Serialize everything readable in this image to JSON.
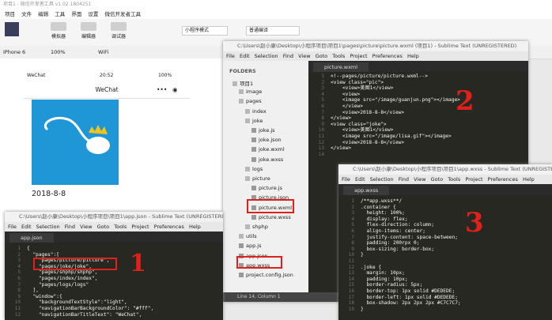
{
  "ide": {
    "title": "项目1 - 微信开发者工具 v1.02.1804251",
    "menu": [
      "项目",
      "文件",
      "编辑",
      "工具",
      "界面",
      "设置",
      "微信开发者工具"
    ],
    "toolbar": {
      "simulator": "模拟器",
      "editor": "编辑器",
      "debugger": "调试器",
      "mode": "小程序模式",
      "compile": "普通编译"
    },
    "device": "iPhone 6",
    "zoom": "100%",
    "network": "WiFi"
  },
  "phone": {
    "carrier": "WeChat",
    "time": "20:52",
    "battery": "100%",
    "nav_title": "WeChat",
    "date_text": "2018-8-8"
  },
  "top_window": {
    "title": "C:\\Users\\赵小康\\Desktop\\小程序项目\\项目1\\pages\\picture\\picture.wxml (项目1) - Sublime Text (UNREGISTERED)",
    "menu": [
      "File",
      "Edit",
      "Selection",
      "Find",
      "View",
      "Goto",
      "Tools",
      "Project",
      "Preferences",
      "Help"
    ],
    "tab": "picture.wxml",
    "sidebar_header": "FOLDERS",
    "tree": [
      {
        "label": "项目1",
        "kind": "folder"
      },
      {
        "label": "image",
        "kind": "folder"
      },
      {
        "label": "pages",
        "kind": "folder"
      },
      {
        "label": "index",
        "kind": "folder"
      },
      {
        "label": "joke",
        "kind": "folder"
      },
      {
        "label": "joke.js",
        "kind": "file"
      },
      {
        "label": "joke.json",
        "kind": "file"
      },
      {
        "label": "joke.wxml",
        "kind": "file"
      },
      {
        "label": "joke.wxss",
        "kind": "file"
      },
      {
        "label": "logs",
        "kind": "folder"
      },
      {
        "label": "picture",
        "kind": "folder"
      },
      {
        "label": "picture.js",
        "kind": "file"
      },
      {
        "label": "picture.json",
        "kind": "file"
      },
      {
        "label": "picture.wxml",
        "kind": "file"
      },
      {
        "label": "picture.wxss",
        "kind": "file"
      },
      {
        "label": "shphp",
        "kind": "folder"
      },
      {
        "label": "utils",
        "kind": "folder"
      },
      {
        "label": "app.js",
        "kind": "file"
      },
      {
        "label": "app.json",
        "kind": "file"
      },
      {
        "label": "app.wxss",
        "kind": "file"
      },
      {
        "label": "project.config.json",
        "kind": "file"
      }
    ],
    "code": [
      "<!--pages/picture/picture.wxml-->",
      "<view class=\"pic\">",
      "    <view>美图1</view>",
      "    <view>",
      "    <image src=\"/image/guanjun.png\"></image>",
      "    </view>",
      "    <view>2018-8-8</view>",
      "</view>",
      "<view class=\"joke\">",
      "    <view>美图1</view>",
      "    <image src=\"/image/lisa.gif\"></image>",
      "    <view>2018-8-8</view>",
      "</view>",
      ""
    ],
    "status": "Line 14, Column 1"
  },
  "left_window": {
    "title": "C:\\Users\\赵小康\\Desktop\\小程序项目\\项目1\\app.json - Sublime Text (UNREGISTERED)",
    "menu": [
      "File",
      "Edit",
      "Selection",
      "Find",
      "View",
      "Goto",
      "Tools",
      "Project",
      "Preferences",
      "Help"
    ],
    "tab": "app.json",
    "code": [
      "{",
      "  \"pages\":[",
      "    \"pages/picture/picture\",",
      "    \"pages/joke/joke\",",
      "    \"pages/shphp/shphp\",",
      "    \"pages/index/index\",",
      "    \"pages/logs/logs\"",
      "  ],",
      "  \"window\":{",
      "    \"backgroundTextStyle\":\"light\",",
      "    \"navigationBarBackgroundColor\": \"#fff\",",
      "    \"navigationBarTitleText\": \"WeChat\","
    ]
  },
  "right_window": {
    "title": "C:\\Users\\赵小康\\Desktop\\小程序项目\\项目1\\app.wxss - Sublime Text (UNREGISTERED)",
    "menu": [
      "File",
      "Edit",
      "Selection",
      "Find",
      "View",
      "Goto",
      "Tools",
      "Project",
      "Preferences",
      "Help"
    ],
    "tab": "app.wxss",
    "code": [
      "/**app.wxss**/",
      ".container {",
      "  height: 100%;",
      "  display: flex;",
      "  flex-direction: column;",
      "  align-items: center;",
      "  justify-content: space-between;",
      "  padding: 200rpx 0;",
      "  box-sizing: border-box;",
      "}",
      "",
      ".joke {",
      "  margin: 10px;",
      "  padding: 10px;",
      "  border-radius: 5px;",
      "  border-top: 1px solid #DEDEDE;",
      "  border-left: 1px solid #DEDEDE;",
      "  box-shadow: 2px 2px 2px #C7C7C7;",
      "}"
    ]
  },
  "annotations": {
    "one": "1",
    "two": "2",
    "three": "3"
  },
  "colors": {
    "annotation": "#e0201a",
    "editor_bg": "#272822",
    "blue_bg": "#1f97d6"
  }
}
